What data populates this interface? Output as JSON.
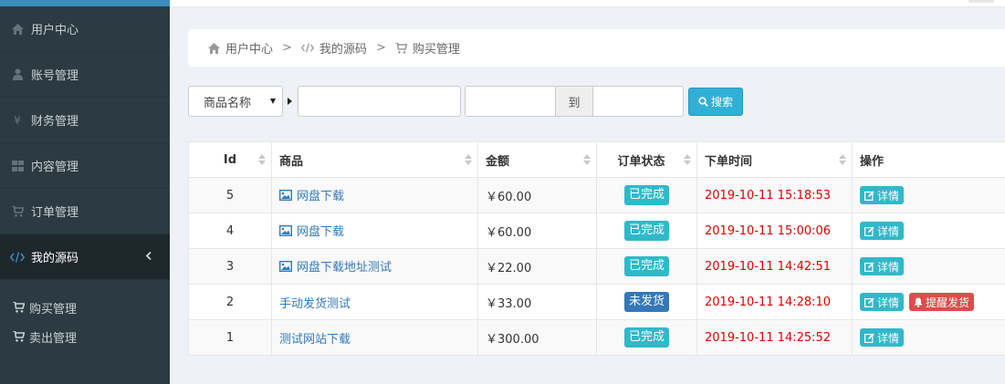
{
  "sidebar": {
    "items": [
      {
        "label": "用户中心",
        "icon": "home-icon"
      },
      {
        "label": "账号管理",
        "icon": "user-icon"
      },
      {
        "label": "财务管理",
        "icon": "yen-icon"
      },
      {
        "label": "内容管理",
        "icon": "grid-icon"
      },
      {
        "label": "订单管理",
        "icon": "cart-icon"
      },
      {
        "label": "我的源码",
        "icon": "code-icon",
        "active": true
      }
    ],
    "sub_items": [
      {
        "label": "购买管理",
        "icon": "cart-icon"
      },
      {
        "label": "卖出管理",
        "icon": "cart-icon"
      }
    ]
  },
  "breadcrumb": {
    "items": [
      "用户中心",
      "我的源码",
      "购买管理"
    ],
    "sep": ">"
  },
  "filters": {
    "select_value": "商品名称",
    "range_to": "到",
    "search_label": "搜索"
  },
  "table": {
    "headers": [
      "Id",
      "商品",
      "金额",
      "订单状态",
      "下单时间",
      "操作"
    ],
    "rows": [
      {
        "id": "5",
        "product": "网盘下载",
        "product_icon": true,
        "amount": "￥60.00",
        "status": "已完成",
        "time": "2019-10-11 15:18:53",
        "actions": [
          "详情"
        ]
      },
      {
        "id": "4",
        "product": "网盘下载",
        "product_icon": true,
        "amount": "￥60.00",
        "status": "已完成",
        "time": "2019-10-11 15:00:06",
        "actions": [
          "详情"
        ]
      },
      {
        "id": "3",
        "product": "网盘下载地址测试",
        "product_icon": true,
        "amount": "￥22.00",
        "status": "已完成",
        "time": "2019-10-11 14:42:51",
        "actions": [
          "详情"
        ]
      },
      {
        "id": "2",
        "product": "手动发货测试",
        "product_icon": false,
        "amount": "￥33.00",
        "status": "未发货",
        "time": "2019-10-11 14:28:10",
        "actions": [
          "详情",
          "提醒发货"
        ]
      },
      {
        "id": "1",
        "product": "测试网站下载",
        "product_icon": false,
        "amount": "￥300.00",
        "status": "已完成",
        "time": "2019-10-11 14:25:52",
        "actions": [
          "详情"
        ]
      }
    ]
  },
  "colors": {
    "sidebar_bg": "#2c3b41",
    "accent": "#3c8dbc",
    "info": "#31b8c9",
    "primary_badge": "#3478b8",
    "danger": "#e04b4b",
    "time_red": "#dd0000"
  }
}
